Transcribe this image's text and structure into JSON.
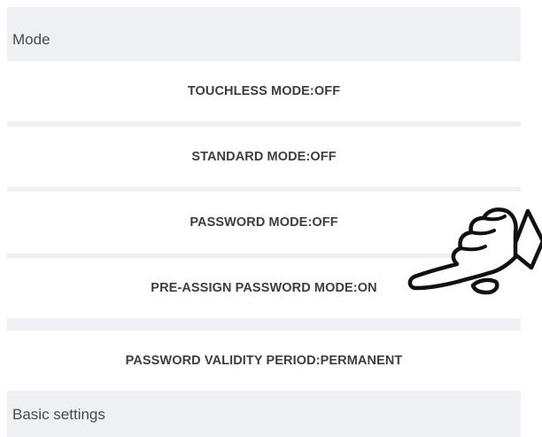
{
  "sections": [
    {
      "title": "Mode",
      "rows": [
        {
          "label": "TOUCHLESS MODE:OFF"
        },
        {
          "label": "STANDARD MODE:OFF"
        },
        {
          "label": "PASSWORD MODE:OFF"
        },
        {
          "label": "PRE-ASSIGN PASSWORD MODE:ON"
        },
        {
          "label": "PASSWORD VALIDITY PERIOD:PERMANENT"
        }
      ]
    },
    {
      "title": "Basic settings"
    }
  ],
  "pointer": {
    "icon": "pointing-hand-icon"
  }
}
